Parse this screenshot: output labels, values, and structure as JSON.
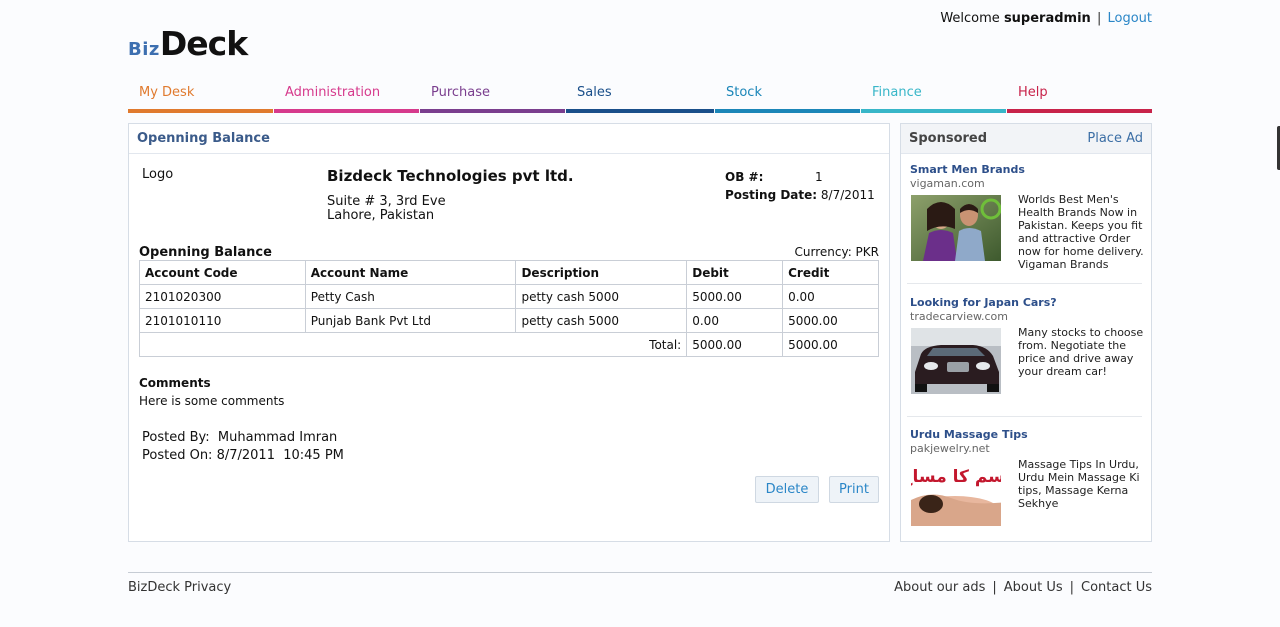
{
  "header": {
    "welcome_prefix": "Welcome",
    "username": "superadmin",
    "separator": "|",
    "logout_label": "Logout",
    "logo_biz": "Biz",
    "logo_deck": "Deck"
  },
  "nav": {
    "tabs": [
      {
        "label": "My Desk",
        "color": "#e07a2e"
      },
      {
        "label": "Administration",
        "color": "#d63a8c"
      },
      {
        "label": "Purchase",
        "color": "#7a3e8e"
      },
      {
        "label": "Sales",
        "color": "#1a4f8a"
      },
      {
        "label": "Stock",
        "color": "#1b86b8"
      },
      {
        "label": "Finance",
        "color": "#38b6c8"
      },
      {
        "label": "Help",
        "color": "#c8234a"
      }
    ]
  },
  "panel": {
    "title": "Openning Balance",
    "logo_text": "Logo",
    "company": "Bizdeck Technologies pvt ltd.",
    "address_line1": "Suite # 3, 3rd Eve",
    "address_line2": "Lahore, Pakistan",
    "ob_label": "OB #:",
    "ob_value": "1",
    "posting_date_label": "Posting Date:",
    "posting_date_value": "8/7/2011",
    "section_title": "Openning Balance",
    "currency": "Currency: PKR",
    "table": {
      "headers": [
        "Account Code",
        "Account Name",
        "Description",
        "Debit",
        "Credit"
      ],
      "rows": [
        [
          "2101020300",
          "Petty Cash",
          "petty cash 5000",
          "5000.00",
          "0.00"
        ],
        [
          "2101010110",
          "Punjab Bank Pvt Ltd",
          "petty cash 5000",
          "0.00",
          "5000.00"
        ]
      ],
      "total_label": "Total:",
      "total_debit": "5000.00",
      "total_credit": "5000.00"
    },
    "comments_title": "Comments",
    "comments_text": "Here is some comments",
    "posted_by_label": "Posted By:",
    "posted_by_value": "Muhammad Imran",
    "posted_on_label": "Posted On:",
    "posted_on_value": "8/7/2011  10:45 PM",
    "delete_label": "Delete",
    "print_label": "Print"
  },
  "sponsored": {
    "title": "Sponsored",
    "place_ad_label": "Place Ad",
    "ads": [
      {
        "title": "Smart Men Brands",
        "domain": "vigaman.com",
        "text": "Worlds Best Men's Health Brands Now in Pakistan. Keeps you fit and attractive Order now for home delivery. Vigaman Brands",
        "image_icon": "couple-photo"
      },
      {
        "title": "Looking for Japan Cars?",
        "domain": "tradecarview.com",
        "text": "Many stocks to choose from. Negotiate the price and drive away your dream car!",
        "image_icon": "car-photo"
      },
      {
        "title": "Urdu Massage Tips",
        "domain": "pakjewelry.net",
        "text": "Massage Tips In Urdu, Urdu Mein Massage Ki tips, Massage Kerna Sekhye",
        "image_icon": "massage-photo",
        "image_caption": "جسم کا مساج"
      }
    ]
  },
  "footer": {
    "privacy_label": "BizDeck Privacy",
    "links": [
      "About our ads",
      "About Us",
      "Contact Us"
    ],
    "separator": "|"
  }
}
